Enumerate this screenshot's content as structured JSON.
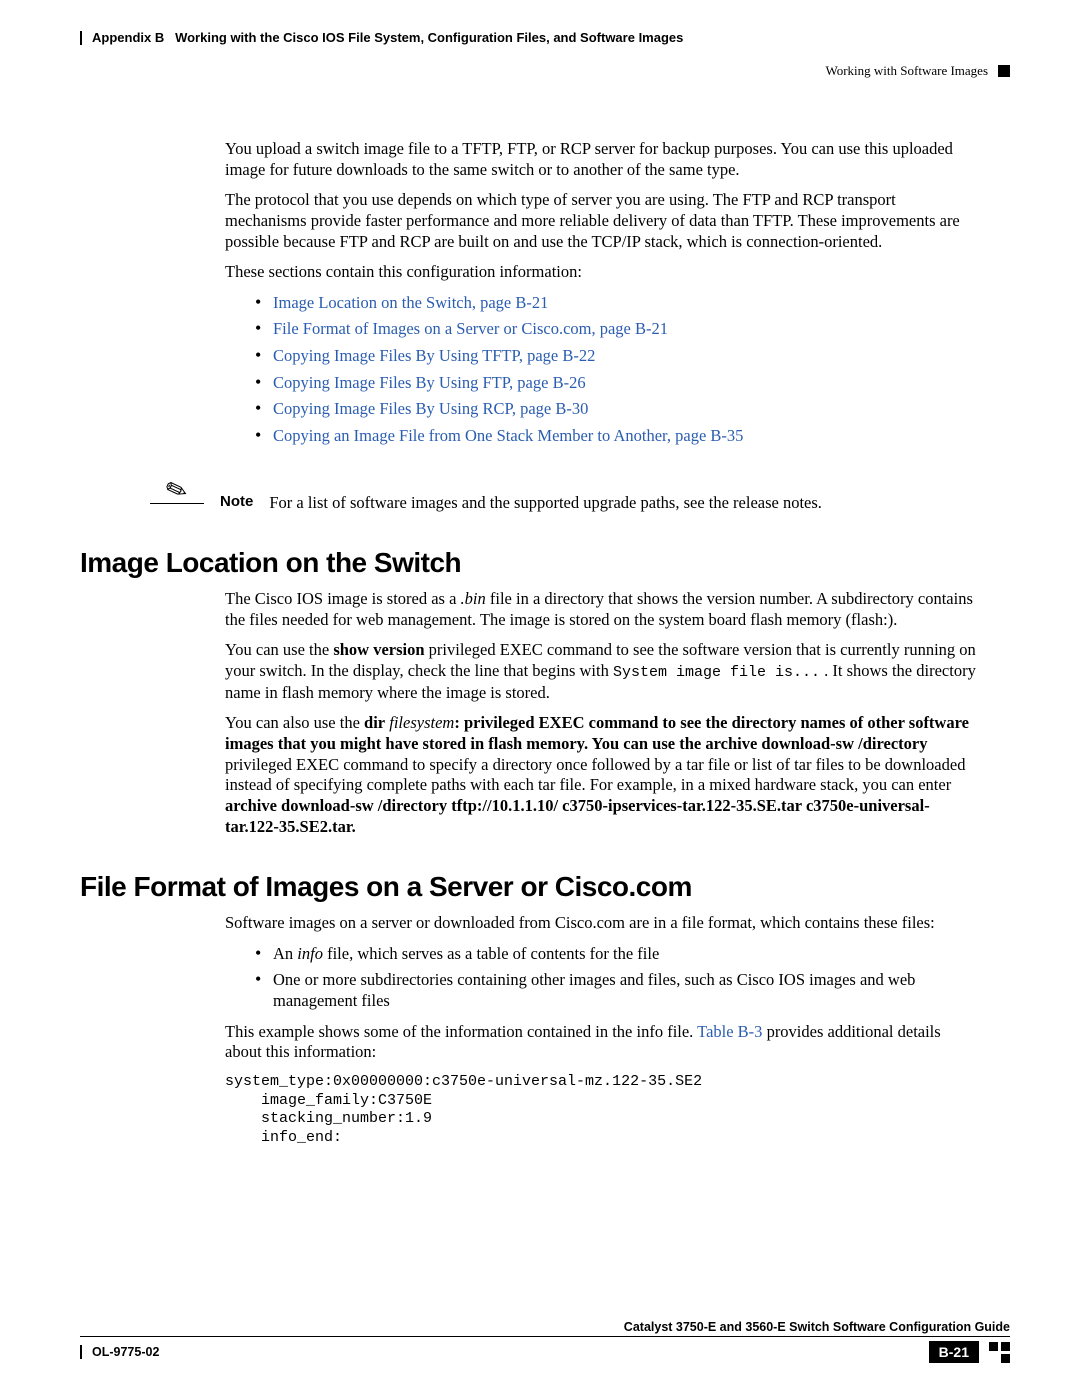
{
  "header": {
    "appendix": "Appendix B",
    "title": "Working with the Cisco IOS File System, Configuration Files, and Software Images",
    "section": "Working with Software Images"
  },
  "intro": {
    "p1": "You upload a switch image file to a TFTP, FTP, or RCP server for backup purposes. You can use this uploaded image for future downloads to the same switch or to another of the same type.",
    "p2": "The protocol that you use depends on which type of server you are using. The FTP and RCP transport mechanisms provide faster performance and more reliable delivery of data than TFTP. These improvements are possible because FTP and RCP are built on and use the TCP/IP stack, which is connection-oriented.",
    "p3": "These sections contain this configuration information:"
  },
  "links": {
    "l1": "Image Location on the Switch, page B-21",
    "l2": "File Format of Images on a Server or Cisco.com, page B-21",
    "l3": "Copying Image Files By Using TFTP, page B-22",
    "l4": "Copying Image Files By Using FTP, page B-26",
    "l5": "Copying Image Files By Using RCP, page B-30",
    "l6": "Copying an Image File from One Stack Member to Another, page B-35"
  },
  "note": {
    "label": "Note",
    "text": "For a list of software images and the supported upgrade paths, see the release notes."
  },
  "section1": {
    "heading": "Image Location on the Switch",
    "p1a": "The Cisco IOS image is stored as a ",
    "p1b": ".bin",
    "p1c": " file in a directory that shows the version number. A subdirectory contains the files needed for web management. The image is stored on the system board flash memory (flash:).",
    "p2a": "You can use the ",
    "p2b": "show version",
    "p2c": " privileged EXEC command to see the software version that is currently running on your switch. In the display, check the line that begins with ",
    "p2d": "System image file is...",
    "p2e": " . It shows the directory name in flash memory where the image is stored.",
    "p3a": "You can also use the ",
    "p3b": "dir",
    "p3c": " filesystem",
    "p3d": ": privileged EXEC command to see the directory names of other software images that you might have stored in flash memory. You can use the ",
    "p3e": "archive download-sw /directory",
    "p3f": " privileged EXEC command to specify a directory once followed by a tar file or list of tar files to be downloaded instead of specifying complete paths with each tar file. For example, in a mixed hardware stack, you can enter ",
    "p3g": "archive download-sw /directory tftp://10.1.1.10/ c3750-ipservices-tar.122-35.SE.tar c3750e-universal-tar.122-35.SE2.tar."
  },
  "section2": {
    "heading": "File Format of Images on a Server or Cisco.com",
    "p1": "Software images on a server or downloaded from Cisco.com are in a file format, which contains these files:",
    "b1a": "An ",
    "b1b": "info",
    "b1c": " file, which serves as a table of contents for the file",
    "b2": "One or more subdirectories containing other images and files, such as Cisco IOS images and web management files",
    "p2a": "This example shows some of the information contained in the info file. ",
    "p2b": "Table B-3",
    "p2c": " provides additional details about this information:",
    "code": "system_type:0x00000000:c3750e-universal-mz.122-35.SE2\n    image_family:C3750E\n    stacking_number:1.9\n    info_end:"
  },
  "footer": {
    "guide": "Catalyst 3750-E and 3560-E Switch Software Configuration Guide",
    "docnum": "OL-9775-02",
    "pagenum": "B-21"
  }
}
